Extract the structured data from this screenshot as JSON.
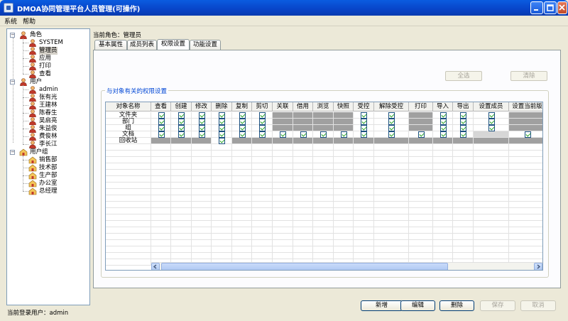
{
  "window": {
    "title": "DMOA协同管理平台人员管理(可操作)"
  },
  "menu": [
    "系统",
    "帮助"
  ],
  "tree": {
    "roles_label": "角色",
    "roles": [
      "SYSTEM",
      "管理员",
      "应用",
      "打印",
      "查看"
    ],
    "users_label": "用户",
    "users": [
      "admin",
      "张有光",
      "王建林",
      "陈春生",
      "吴启亮",
      "朱益俊",
      "费俊林",
      "李长江"
    ],
    "groups_label": "用户组",
    "groups": [
      "销售部",
      "技术部",
      "生产部",
      "办公室",
      "总经理"
    ],
    "selected": "管理员"
  },
  "current_role": "当前角色：管理员",
  "tabs": [
    "基本属性",
    "成员列表",
    "权限设置",
    "功能设置"
  ],
  "active_tab": "权限设置",
  "select_all_label": "全选",
  "clear_label": "清除",
  "group_title": "与对象有关的权限设置",
  "table": {
    "columns": [
      "对象名称",
      "查看",
      "创建",
      "修改",
      "删除",
      "复制",
      "剪切",
      "关联",
      "借用",
      "浏览",
      "快照",
      "受控",
      "解除受控",
      "打印",
      "导入",
      "导出",
      "设置成员",
      "设置当前版"
    ],
    "rows": [
      {
        "name": "文件夹",
        "cells": [
          "c",
          "c",
          "c",
          "c",
          "c",
          "c",
          "g",
          "g",
          "g",
          "g",
          "c",
          "c",
          "g",
          "c",
          "c",
          "c",
          "g"
        ]
      },
      {
        "name": "部门",
        "cells": [
          "c",
          "c",
          "c",
          "c",
          "c",
          "c",
          "g",
          "g",
          "g",
          "g",
          "c",
          "c",
          "g",
          "c",
          "c",
          "c",
          "g"
        ]
      },
      {
        "name": "组",
        "cells": [
          "c",
          "c",
          "c",
          "c",
          "c",
          "c",
          "g",
          "g",
          "g",
          "g",
          "c",
          "c",
          "g",
          "c",
          "c",
          "c",
          "g"
        ]
      },
      {
        "name": "文档",
        "cells": [
          "c",
          "c",
          "c",
          "c",
          "c",
          "c",
          "c",
          "c",
          "c",
          "c",
          "c",
          "c",
          "c",
          "c",
          "c",
          "l",
          "c"
        ]
      },
      {
        "name": "回收站",
        "cells": [
          "g",
          "g",
          "g",
          "c",
          "g",
          "g",
          "g",
          "g",
          "g",
          "g",
          "g",
          "g",
          "g",
          "g",
          "g",
          "g",
          "g"
        ]
      }
    ]
  },
  "status": "当前登录用户：admin",
  "buttons": {
    "new": "新增",
    "edit": "编辑",
    "delete": "删除",
    "save": "保存",
    "cancel": "取消"
  },
  "colors": {
    "title_bar": "#0a5ce0",
    "group_title": "#0046d5",
    "check": "#21a121"
  }
}
